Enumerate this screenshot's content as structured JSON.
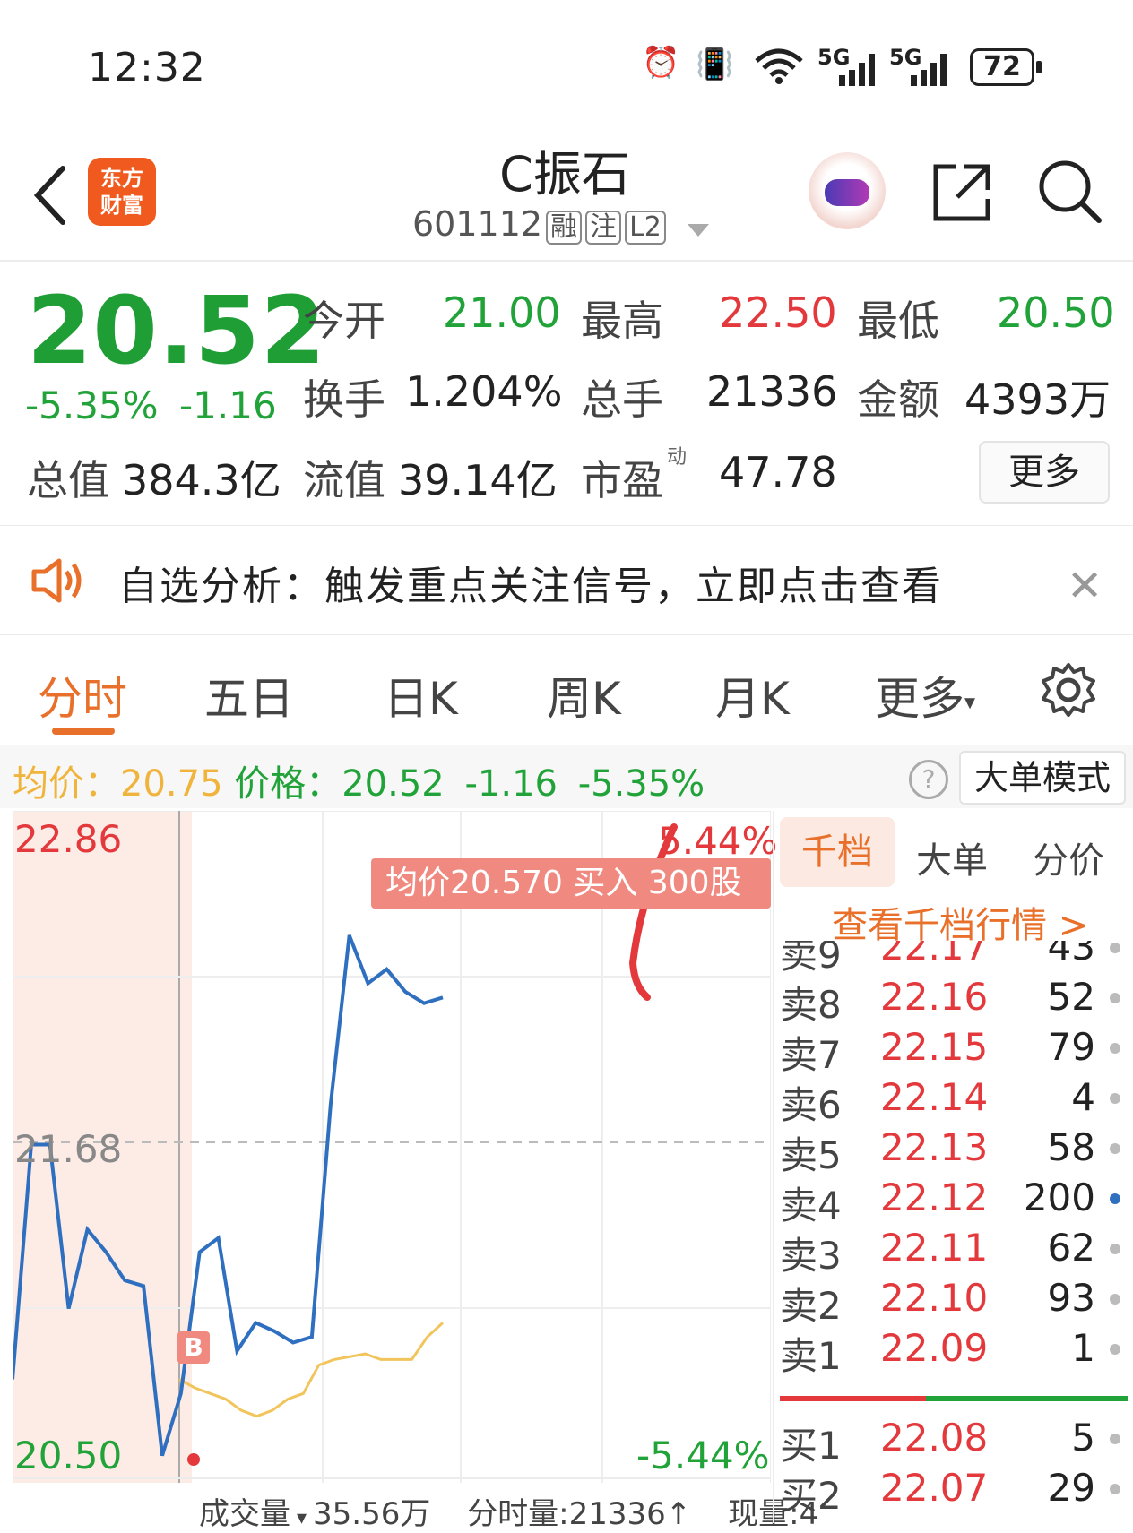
{
  "status_bar": {
    "time": "12:32",
    "battery": "72",
    "net1": "5G",
    "net2": "5G"
  },
  "header": {
    "logo_line1": "东方",
    "logo_line2": "财富",
    "stock_name": "C振石",
    "stock_code": "601112",
    "tags": [
      "融",
      "注",
      "L2"
    ]
  },
  "quote": {
    "price": "20.52",
    "change_pct": "-5.35%",
    "change": "-1.16",
    "open_label": "今开",
    "open": "21.00",
    "high_label": "最高",
    "high": "22.50",
    "low_label": "最低",
    "low": "20.50",
    "turnover_label": "换手",
    "turnover": "1.204%",
    "volume_label": "总手",
    "volume": "21336",
    "amount_label": "金额",
    "amount": "4393万",
    "mktcap_label": "总值",
    "mktcap": "384.3亿",
    "float_label": "流值",
    "float_cap": "39.14亿",
    "pe_label": "市盈",
    "pe_sup": "动",
    "pe": "47.78",
    "more_button": "更多"
  },
  "banner": {
    "text": "自选分析：触发重点关注信号，立即点击查看"
  },
  "tabs": [
    "分时",
    "五日",
    "日K",
    "周K",
    "月K",
    "更多"
  ],
  "info_line": {
    "avg_label": "均价：",
    "avg": "20.75",
    "price_label": "价格：",
    "price": "20.52",
    "change": "-1.16",
    "change_pct": "-5.35%",
    "big_order_mode": "大单模式"
  },
  "chart": {
    "y_high": "22.86",
    "y_mid": "21.68",
    "y_low": "20.50",
    "pct_high": "5.44%",
    "pct_low": "-5.44%",
    "tooltip": "均价20.570  买入 300股",
    "marker": "B",
    "vol_label": "成交量",
    "vol_value": "35.56万",
    "tick_vol": "分时量:21336↑",
    "cur_vol": "现量:4"
  },
  "chart_data": {
    "type": "line",
    "title": "",
    "ylim": [
      20.5,
      22.86
    ],
    "series": [
      {
        "values": [
          20.85,
          21.68,
          21.68,
          21.1,
          21.38,
          21.3,
          21.2,
          21.18,
          20.58,
          20.8,
          21.3,
          21.35,
          20.95,
          21.05,
          21.02,
          20.98,
          21.0,
          21.82,
          22.42,
          22.25,
          22.3,
          22.22,
          22.18,
          22.2
        ]
      },
      {
        "values": [
          20.85,
          20.82,
          20.8,
          20.78,
          20.74,
          20.72,
          20.74,
          20.78,
          20.8,
          20.9,
          20.92,
          20.93,
          20.94,
          20.92,
          20.92,
          20.92,
          21.0,
          21.05
        ]
      }
    ]
  },
  "order_book": {
    "tabs": [
      "千档",
      "大单",
      "分价"
    ],
    "link": "查看千档行情 >",
    "sells": [
      {
        "label": "卖9",
        "price": "22.17",
        "vol": "43"
      },
      {
        "label": "卖8",
        "price": "22.16",
        "vol": "52"
      },
      {
        "label": "卖7",
        "price": "22.15",
        "vol": "79"
      },
      {
        "label": "卖6",
        "price": "22.14",
        "vol": "4"
      },
      {
        "label": "卖5",
        "price": "22.13",
        "vol": "58"
      },
      {
        "label": "卖4",
        "price": "22.12",
        "vol": "200"
      },
      {
        "label": "卖3",
        "price": "22.11",
        "vol": "62"
      },
      {
        "label": "卖2",
        "price": "22.10",
        "vol": "93"
      },
      {
        "label": "卖1",
        "price": "22.09",
        "vol": "1"
      }
    ],
    "buys": [
      {
        "label": "买1",
        "price": "22.08",
        "vol": "5"
      },
      {
        "label": "买2",
        "price": "22.07",
        "vol": "29"
      }
    ],
    "split_pct": 42
  },
  "colors": {
    "up": "#e4393c",
    "down": "#22a33a",
    "accent": "#e8702a",
    "line": "#2f6fbf",
    "avg_line": "#f2c55c"
  }
}
